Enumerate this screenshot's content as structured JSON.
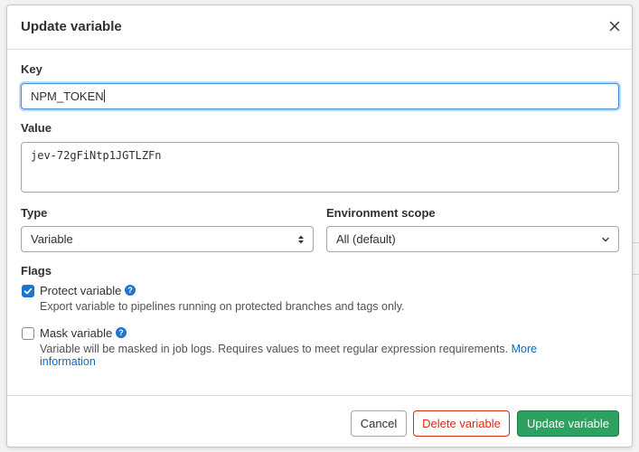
{
  "dialog": {
    "title": "Update variable",
    "close_icon": "close-icon"
  },
  "key": {
    "label": "Key",
    "value": "NPM_TOKEN"
  },
  "value": {
    "label": "Value",
    "value": "jev-72gFiNtp1JGTLZFn"
  },
  "type": {
    "label": "Type",
    "selected": "Variable",
    "icon": "sort-arrows-icon"
  },
  "environment_scope": {
    "label": "Environment scope",
    "selected": "All (default)",
    "icon": "chevron-down-icon"
  },
  "flags": {
    "label": "Flags",
    "protect": {
      "label": "Protect variable",
      "checked": true,
      "help": "Export variable to pipelines running on protected branches and tags only."
    },
    "mask": {
      "label": "Mask variable",
      "checked": false,
      "help": "Variable will be masked in job logs. Requires values to meet regular expression requirements.",
      "link_part1": "More",
      "link_part2": "information"
    }
  },
  "footer": {
    "cancel_label": "Cancel",
    "delete_label": "Delete variable",
    "update_label": "Update variable"
  },
  "colors": {
    "focus_border": "#428fdc",
    "checkbox_checked": "#1f75cb",
    "link": "#1068bf",
    "danger": "#dd2b0e",
    "confirm": "#2da160",
    "help_icon": "#1f75cb"
  }
}
